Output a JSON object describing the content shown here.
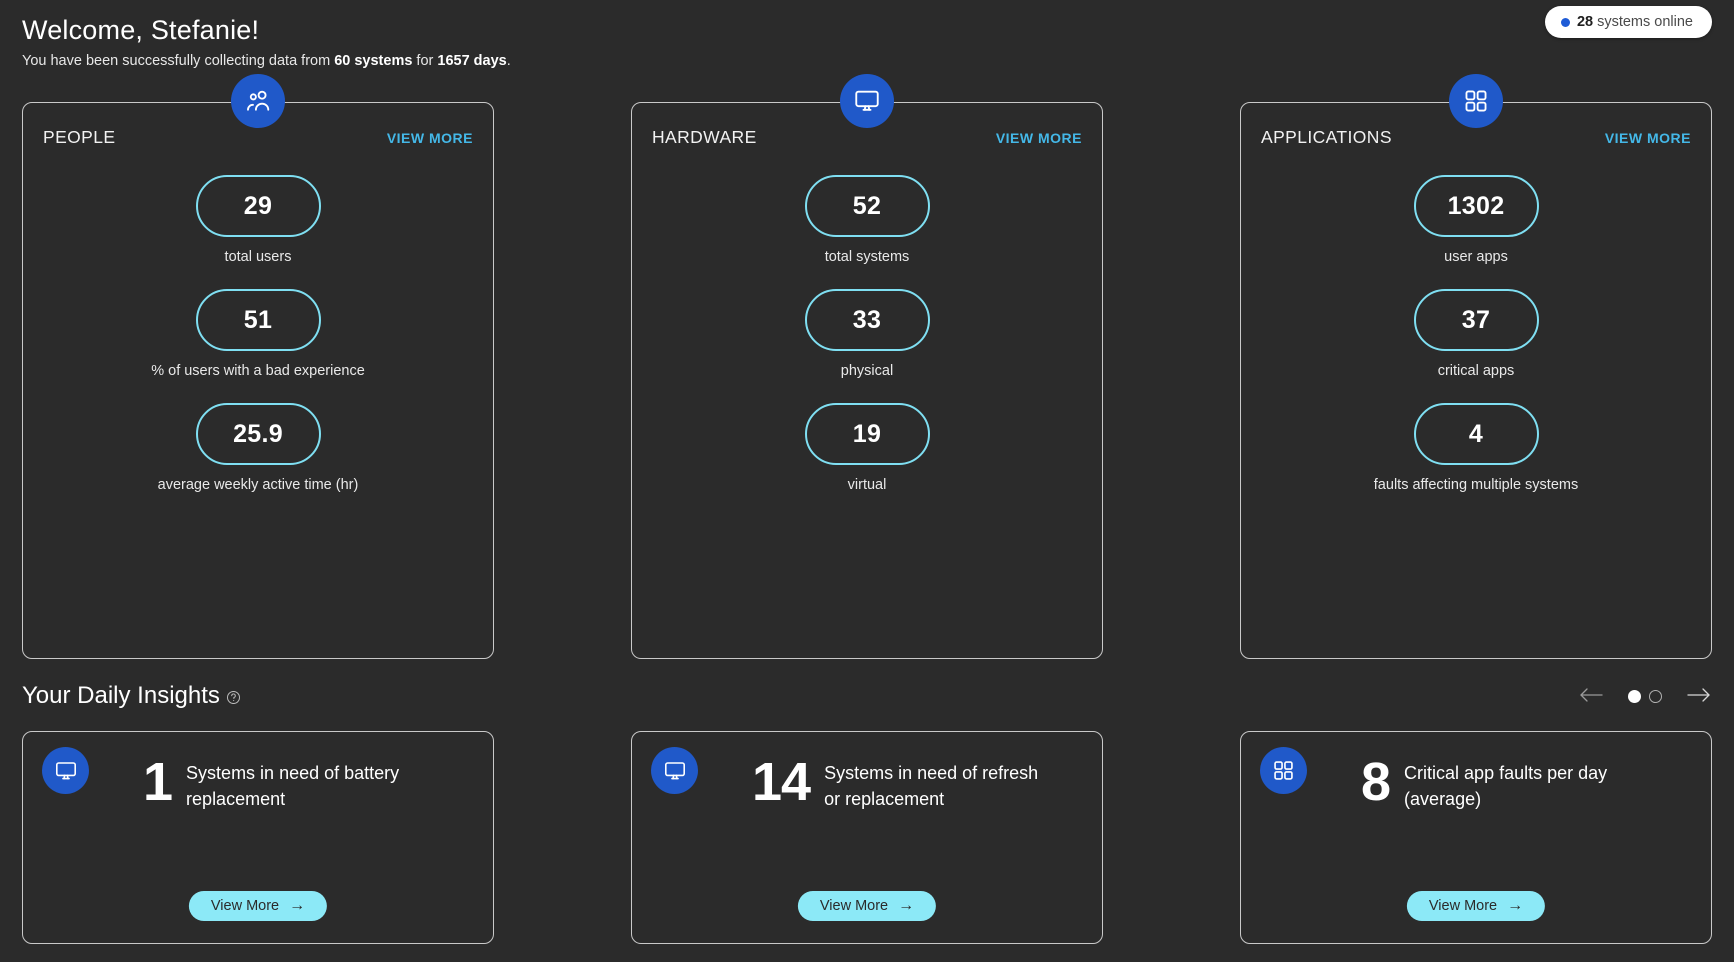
{
  "header": {
    "title": "Welcome, Stefanie!",
    "subtitle_prefix": "You have been successfully collecting data from ",
    "subtitle_systems": "60 systems",
    "subtitle_middle": " for ",
    "subtitle_days": "1657 days",
    "subtitle_suffix": ".",
    "status_count": "28",
    "status_text": "systems online",
    "status_dot_color": "#1e5bd6"
  },
  "colors": {
    "background": "#2b2b2b",
    "card_border": "#c9c9c9",
    "badge_blue": "#2059c9",
    "pill_cyan": "#7fdff2",
    "link_blue": "#44b8e8",
    "button_cyan": "#8ce9f7"
  },
  "cards": [
    {
      "title": "PEOPLE",
      "view_more": "VIEW MORE",
      "icon": "people-icon",
      "metrics": [
        {
          "value": "29",
          "label": "total users"
        },
        {
          "value": "51",
          "label": "% of users with a bad experience"
        },
        {
          "value": "25.9",
          "label": "average weekly active time (hr)"
        }
      ]
    },
    {
      "title": "HARDWARE",
      "view_more": "VIEW MORE",
      "icon": "monitor-icon",
      "metrics": [
        {
          "value": "52",
          "label": "total systems"
        },
        {
          "value": "33",
          "label": "physical"
        },
        {
          "value": "19",
          "label": "virtual"
        }
      ]
    },
    {
      "title": "APPLICATIONS",
      "view_more": "VIEW MORE",
      "icon": "apps-grid-icon",
      "metrics": [
        {
          "value": "1302",
          "label": "user apps"
        },
        {
          "value": "37",
          "label": "critical apps"
        },
        {
          "value": "4",
          "label": "faults affecting multiple systems"
        }
      ]
    }
  ],
  "insights": {
    "heading": "Your Daily Insights",
    "pagination": {
      "current": 1,
      "total": 2
    },
    "cards": [
      {
        "icon": "monitor-icon",
        "number": "1",
        "text": "Systems in need of battery replacement",
        "button_label": "View More"
      },
      {
        "icon": "monitor-icon",
        "number": "14",
        "text": "Systems in need of refresh or replacement",
        "button_label": "View More"
      },
      {
        "icon": "apps-grid-icon",
        "number": "8",
        "text": "Critical app faults per day (average)",
        "button_label": "View More"
      }
    ]
  }
}
